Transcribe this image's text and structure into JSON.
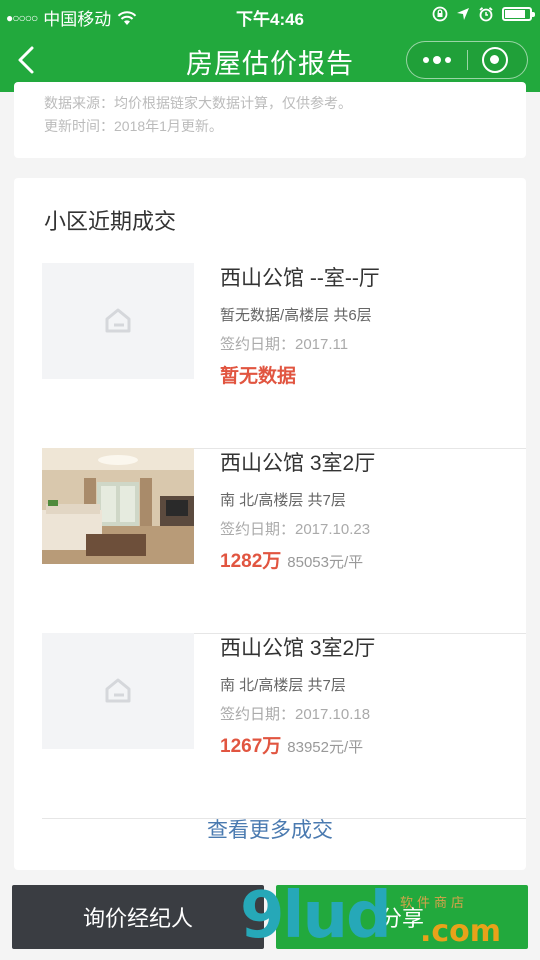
{
  "status_bar": {
    "signal": "●○○○○",
    "carrier": "中国移动",
    "time": "下午4:46",
    "battery_level": 0.85
  },
  "nav": {
    "title": "房屋估价报告"
  },
  "info_card": {
    "source_text": "数据来源：均价根据链家大数据计算，仅供参考。",
    "update_text": "更新时间：2018年1月更新。"
  },
  "deals_section": {
    "heading": "小区近期成交",
    "items": [
      {
        "name": "西山公馆 --室--厅",
        "meta": "暂无数据/高楼层 共6层",
        "date": "签约日期：2017.11",
        "price": "暂无数据",
        "unit_price": "",
        "has_photo": false
      },
      {
        "name": "西山公馆 3室2厅",
        "meta": "南 北/高楼层 共7层",
        "date": "签约日期：2017.10.23",
        "price": "1282万",
        "unit_price": "85053元/平",
        "has_photo": true
      },
      {
        "name": "西山公馆 3室2厅",
        "meta": "南 北/高楼层 共7层",
        "date": "签约日期：2017.10.18",
        "price": "1267万",
        "unit_price": "83952元/平",
        "has_photo": false
      }
    ],
    "more_link": "查看更多成交"
  },
  "bottom_bar": {
    "agent_button": "询价经纪人",
    "share_button": "分享"
  },
  "watermark": {
    "main": "9lud",
    "dotcom": ".com",
    "sub": "软件商店"
  },
  "colors": {
    "brand_green": "#22a93d",
    "price_red": "#e15540",
    "link_blue": "#4a7ab0",
    "dark_button": "#3a3d42"
  }
}
